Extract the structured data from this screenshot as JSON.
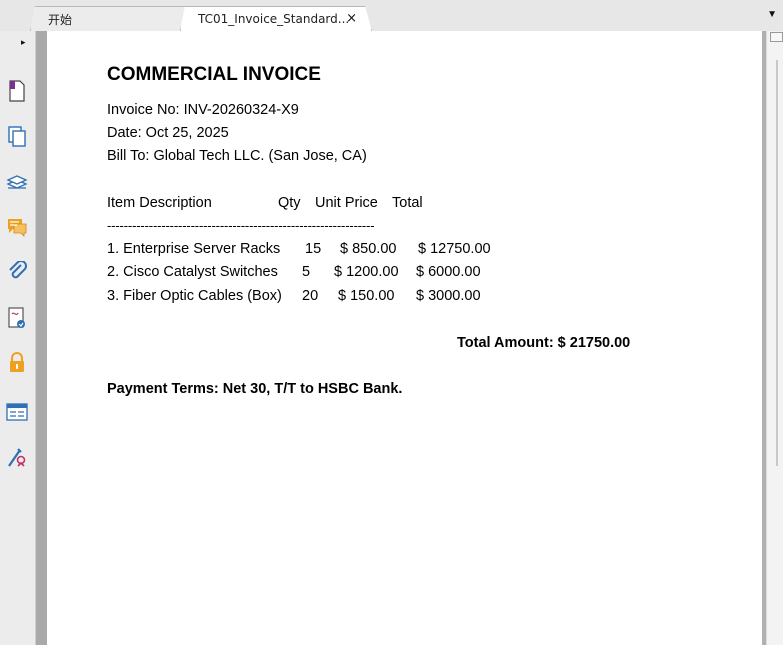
{
  "tabs": [
    {
      "label": "开始"
    },
    {
      "label": "TC01_Invoice_Standard...",
      "close": "×"
    }
  ],
  "tab_menu_icon": "▼",
  "sidebar": {
    "collapse_icon": "▸",
    "items": [
      {
        "icon": "page-icon"
      },
      {
        "icon": "pages-icon"
      },
      {
        "icon": "layers-icon"
      },
      {
        "icon": "comments-icon"
      },
      {
        "icon": "attachment-icon"
      },
      {
        "icon": "signature-icon"
      },
      {
        "icon": "lock-icon"
      },
      {
        "icon": "form-fields-icon"
      },
      {
        "icon": "certificate-icon"
      }
    ]
  },
  "invoice": {
    "title": "COMMERCIAL INVOICE",
    "invoice_no": "Invoice No: INV-20260324-X9",
    "date": "Date: Oct 25, 2025",
    "bill_to": "Bill To: Global Tech LLC. (San Jose, CA)",
    "headers": {
      "description": "Item Description",
      "qty": "Qty",
      "unit_price": "Unit Price",
      "total": "Total"
    },
    "separator": "----------------------------------------------------------------",
    "rows": [
      {
        "description": "1. Enterprise Server Racks",
        "qty": "15",
        "unit_price": "$ 850.00",
        "total": "$ 12750.00"
      },
      {
        "description": "2. Cisco Catalyst Switches",
        "qty": "5",
        "unit_price": "$ 1200.00",
        "total": "$ 6000.00"
      },
      {
        "description": "3. Fiber Optic Cables (Box)",
        "qty": "20",
        "unit_price": "$ 150.00",
        "total": "$ 3000.00"
      }
    ],
    "total_amount": "Total Amount: $ 21750.00",
    "payment_terms": "Payment Terms: Net 30, T/T to HSBC Bank."
  },
  "colors": {
    "accent_orange": "#f0a020",
    "icon_blue": "#2f6fb5",
    "icon_purple": "#7b2f8f"
  }
}
